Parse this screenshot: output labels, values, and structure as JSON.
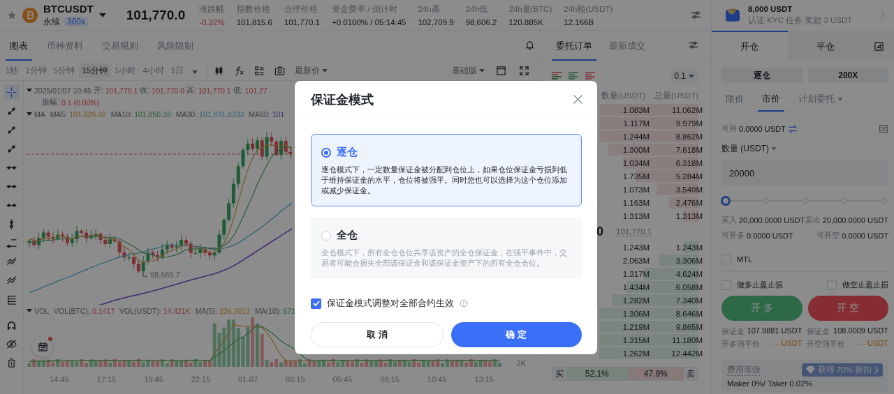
{
  "header": {
    "symbol": "BTCUSDT",
    "contract_type": "永续",
    "leverage_badge": "300x",
    "last_price": "101,770.0",
    "stats": [
      {
        "label": "涨跌幅",
        "value": "-0.32%",
        "kind": "down"
      },
      {
        "label": "指数价格",
        "value": "101,815.6",
        "kind": "plain"
      },
      {
        "label": "合理价格",
        "value": "101,770.1",
        "kind": "plain"
      },
      {
        "label": "资金费率 / 倒计时",
        "value": "+0.0100% / 05:14:45",
        "kind": "plain"
      },
      {
        "label": "24h高",
        "value": "102,709.9",
        "kind": "plain"
      },
      {
        "label": "24h低",
        "value": "98,606.2",
        "kind": "plain"
      },
      {
        "label": "24h量(BTC)",
        "value": "120.885K",
        "kind": "plain"
      },
      {
        "label": "24h额(USDT)",
        "value": "12.166B",
        "kind": "plain"
      }
    ]
  },
  "chart_tabs": [
    {
      "label": "图表",
      "selected": true
    },
    {
      "label": "币种资料",
      "selected": false
    },
    {
      "label": "交易规则",
      "selected": false
    },
    {
      "label": "风险限制",
      "selected": false
    }
  ],
  "intervals": [
    {
      "label": "1秒",
      "selected": false
    },
    {
      "label": "1分钟",
      "selected": false
    },
    {
      "label": "5分钟",
      "selected": false
    },
    {
      "label": "15分钟",
      "selected": true
    },
    {
      "label": "1小时",
      "selected": false
    },
    {
      "label": "4小时",
      "selected": false
    },
    {
      "label": "1日",
      "selected": false
    }
  ],
  "price_source": "最新价",
  "chart_version": "基础版",
  "chart_tools": [
    {
      "kind": "crosshair",
      "selected": true
    },
    {
      "kind": "segment",
      "selected": false
    },
    {
      "kind": "segment",
      "selected": false
    },
    {
      "kind": "segment",
      "selected": false
    },
    {
      "kind": "horizontal",
      "selected": false
    },
    {
      "kind": "horizontal",
      "selected": false
    },
    {
      "kind": "horizontal",
      "selected": false
    },
    {
      "kind": "vertical",
      "selected": false
    },
    {
      "kind": "price_line",
      "selected": false
    },
    {
      "kind": "pattern",
      "selected": false
    },
    {
      "kind": "pattern",
      "selected": false
    },
    {
      "kind": "levels",
      "selected": false
    },
    {
      "kind": "magnet",
      "selected": false
    },
    {
      "kind": "hide",
      "selected": false
    },
    {
      "kind": "delete",
      "selected": false
    }
  ],
  "legend": {
    "datetime": "2025/01/07 10:45",
    "ohlc": [
      {
        "label": "开:",
        "value": "101,770.1"
      },
      {
        "label": "收:",
        "value": "101,770.0"
      },
      {
        "label": "高:",
        "value": "101,770.1"
      },
      {
        "label": "低:",
        "value": "101,77"
      }
    ],
    "amplitude_label": "振幅:",
    "amplitude": "0.1 (0.00%)"
  },
  "ma_legend": {
    "title": "MA",
    "items": [
      {
        "label": "MA5:",
        "value": "101,826.02"
      },
      {
        "label": "MA10:",
        "value": "101,850.39"
      },
      {
        "label": "MA30:",
        "value": "101,931.8333"
      },
      {
        "label": "MA60:",
        "value": "101"
      }
    ]
  },
  "low_marker": "98,665.7",
  "vol_legend": {
    "title": "VOL",
    "items": [
      {
        "label": "VOL(BTC):",
        "value": "0.1417"
      },
      {
        "label": "VOL(USDT):",
        "value": "14.421K"
      },
      {
        "label": "MA(5):",
        "value": "236.2013"
      },
      {
        "label": "MA(10):",
        "value": "571"
      }
    ]
  },
  "volume_axis_label": "2K",
  "time_axis": [
    "14:45",
    "17:15",
    "19:45",
    "22:15",
    "01-07",
    "03:15",
    "05:45",
    "08:15",
    "10:45",
    "13:15"
  ],
  "order_book": {
    "tabs": [
      {
        "label": "委托订单",
        "selected": true
      },
      {
        "label": "最新成交",
        "selected": false
      }
    ],
    "tick_size": "0.1",
    "columns": [
      "数量(USDT)",
      "总量(USDT)"
    ],
    "asks": [
      {
        "amount": "1.083M",
        "total": "11.062M"
      },
      {
        "amount": "1.117M",
        "total": "9.979M"
      },
      {
        "amount": "1.244M",
        "total": "8.862M"
      },
      {
        "amount": "1.300M",
        "total": "7.618M"
      },
      {
        "amount": "1.034M",
        "total": "6.318M"
      },
      {
        "amount": "1.735M",
        "total": "5.284M"
      },
      {
        "amount": "1.073M",
        "total": "3.549M"
      },
      {
        "amount": "1.163M",
        "total": "2.476M"
      },
      {
        "amount": "1.313M",
        "total": "1.313M"
      }
    ],
    "last_price": "0",
    "mark_price": "101,770.1",
    "bids": [
      {
        "amount": "1.243M",
        "total": "1.243M"
      },
      {
        "amount": "2.063M",
        "total": "3.306M"
      },
      {
        "amount": "1.317M",
        "total": "4.624M"
      },
      {
        "amount": "1.434M",
        "total": "6.058M"
      },
      {
        "amount": "1.282M",
        "total": "7.340M"
      },
      {
        "amount": "1.306M",
        "total": "8.646M"
      },
      {
        "amount": "1.219M",
        "total": "9.865M"
      },
      {
        "amount": "1.315M",
        "total": "11.180M"
      },
      {
        "amount": "1.262M",
        "total": "12.442M"
      }
    ],
    "buy_ratio": {
      "label": "买",
      "value": "52.1%",
      "level": 0.521
    },
    "sell_ratio": {
      "label": "卖",
      "value": "47.9%"
    }
  },
  "promo": {
    "amount": "8,000 USDT",
    "text": "认证 KYC 任务 奖励 3 USDT"
  },
  "position_tabs": [
    {
      "label": "开仓",
      "selected": true
    },
    {
      "label": "平仓",
      "selected": false
    }
  ],
  "margin_mode_button": "逐仓",
  "leverage_button": "200X",
  "order_types": [
    {
      "label": "限价",
      "selected": false
    },
    {
      "label": "市价",
      "selected": true
    },
    {
      "label": "计划委托",
      "selected": false
    }
  ],
  "available": {
    "label": "可用",
    "value": "0.0000 USDT"
  },
  "quantity_label": "数量 (USDT)",
  "quantity": "20000",
  "slider": {
    "level": 0
  },
  "buy_amount": {
    "label": "买入",
    "value": "20,000.0000 USDT"
  },
  "sell_amount": {
    "label": "卖出",
    "value": "20,000.0000 USDT"
  },
  "can_open_long": {
    "label": "可开多",
    "value": "0.0000 USDT"
  },
  "can_open_short": {
    "label": "可开空",
    "value": "0.0000 USDT"
  },
  "mtl": {
    "label": "MTL",
    "checked": false
  },
  "tpsl": [
    {
      "label": "做多止盈止损",
      "checked": false
    },
    {
      "label": "做空止盈止损",
      "checked": false
    }
  ],
  "actions": [
    {
      "label": "开 多",
      "kind": "long"
    },
    {
      "label": "开 空",
      "kind": "short"
    }
  ],
  "margin": [
    {
      "label": "保证金",
      "value": "107.9881 USDT"
    },
    {
      "label": "保证金",
      "value": "108.0009 USDT"
    }
  ],
  "liquidation": [
    {
      "label": "开多强平价",
      "value": "- - USDT"
    },
    {
      "label": "开空强平价",
      "value": "- - USDT"
    }
  ],
  "fees": {
    "label": "费用等级",
    "badge": "获得 20% 折扣",
    "text": "Maker 0%/ Taker 0.02%"
  },
  "dialog": {
    "title": "保证金模式",
    "options": [
      {
        "label": "逐仓",
        "selected": true,
        "description": "逐仓模式下，一定数量保证金被分配到仓位上，如果仓位保证金亏损到低于维持保证金的水平，仓位将被强平。同时您也可以选择为这个仓位添加或减少保证金。"
      },
      {
        "label": "全仓",
        "selected": false,
        "description": "全仓模式下，所有全仓仓位共享该资产的全仓保证金，在强平事件中，交易者可能会损失全部该保证金和该保证金资产下的所有全仓仓位。"
      }
    ],
    "apply_all": {
      "label": "保证金模式调整对全部合约生效",
      "checked": true
    },
    "buttons": [
      {
        "label": "取 消",
        "kind": "secondary"
      },
      {
        "label": "确 定",
        "kind": "primary"
      }
    ]
  }
}
